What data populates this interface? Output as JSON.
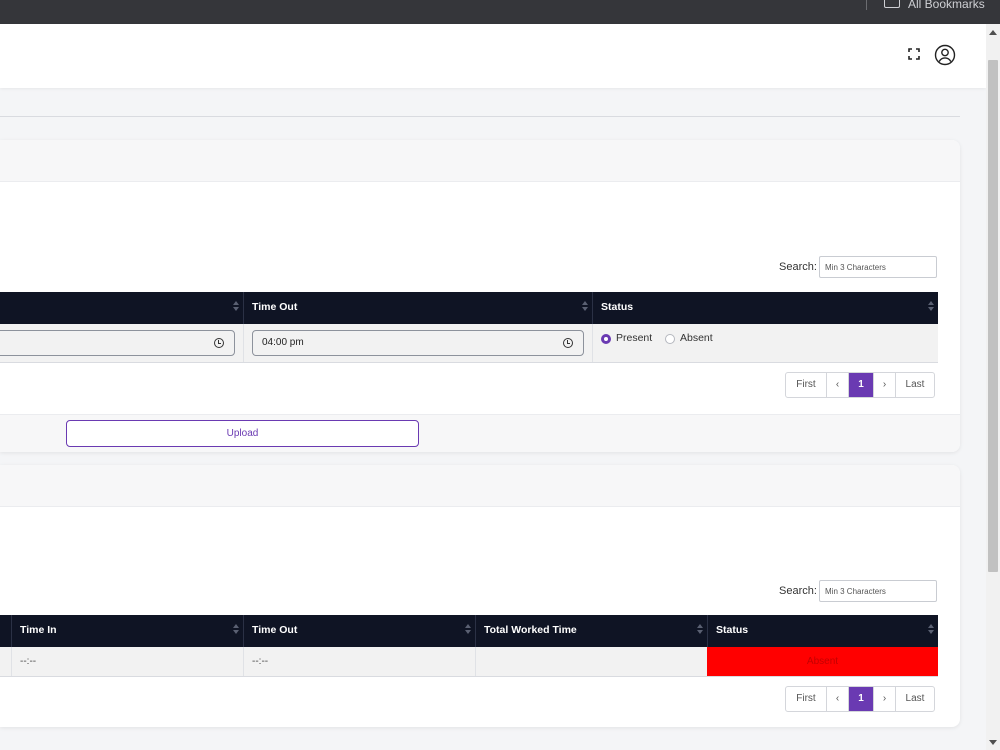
{
  "browser": {
    "bookmarks_label": "All Bookmarks"
  },
  "header": {
    "fullscreen_icon": "fullscreen-icon",
    "user_icon": "user-circle-icon"
  },
  "theme": {
    "accent": "#6a3ab2",
    "table_header": "#0f1424",
    "absent": "#ff0000"
  },
  "attendance_form": {
    "search_label": "Search:",
    "search_placeholder": "Min 3 Characters",
    "columns": [
      "Time Out",
      "Status"
    ],
    "row": {
      "time_out": "04:00 pm",
      "status_options": [
        "Present",
        "Absent"
      ],
      "status_selected": "Present"
    },
    "pagination": [
      "First",
      "‹",
      "1",
      "›",
      "Last"
    ],
    "current_page": "1",
    "upload_label": "Upload"
  },
  "attendance_log": {
    "search_label": "Search:",
    "search_placeholder": "Min 3 Characters",
    "columns": [
      "Time In",
      "Time Out",
      "Total Worked Time",
      "Status"
    ],
    "row": {
      "time_in": "--:--",
      "time_out": "--:--",
      "total_worked_time": "",
      "status": "Absent"
    },
    "pagination": [
      "First",
      "‹",
      "1",
      "›",
      "Last"
    ],
    "current_page": "1"
  }
}
